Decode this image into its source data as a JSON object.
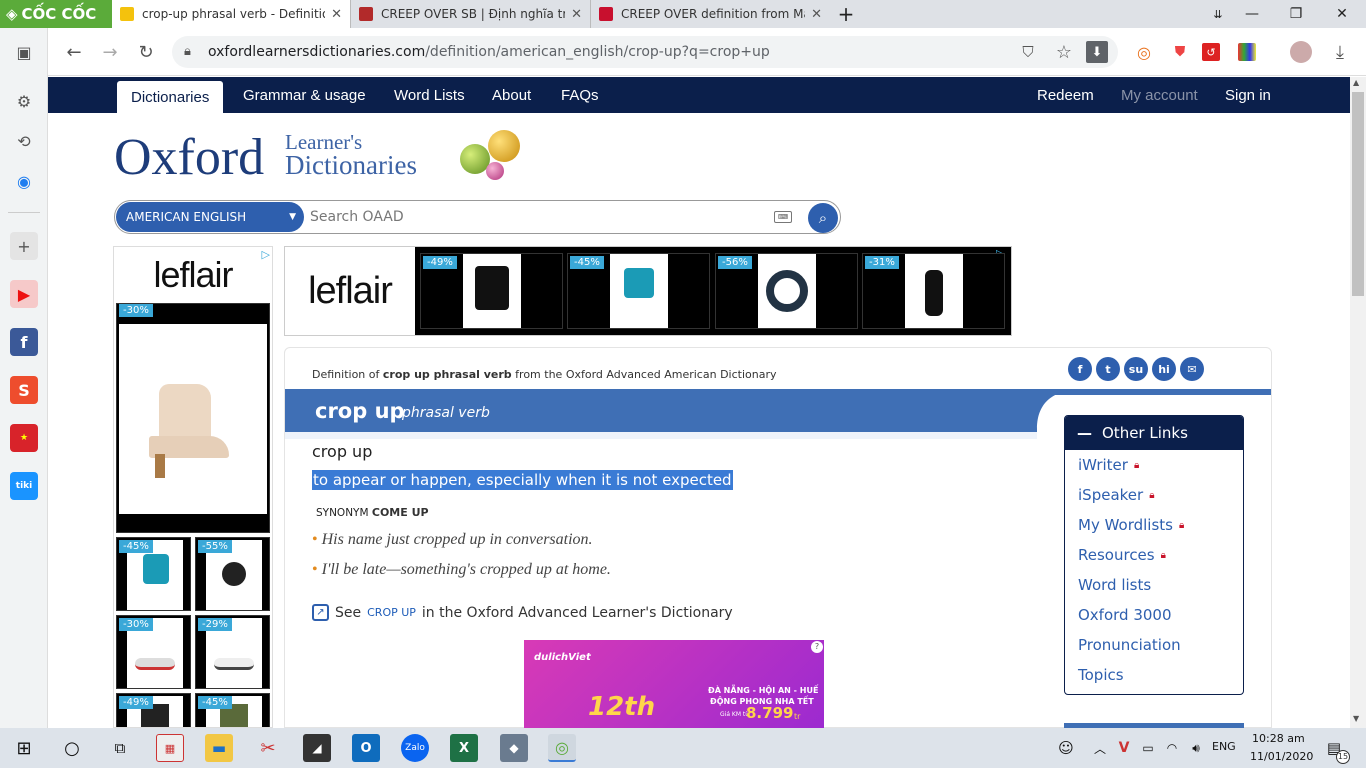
{
  "browser": {
    "brand": "CỐC CỐC",
    "tabs": [
      {
        "label": "crop-up phrasal verb - Definition, p",
        "color": "#f4c20d",
        "active": true
      },
      {
        "label": "CREEP OVER SB | Định nghĩa trong",
        "color": "#b22a2a",
        "active": false
      },
      {
        "label": "CREEP OVER definition from Macm",
        "color": "#c8102e",
        "active": false
      }
    ],
    "new_tab": "+",
    "url_host": "oxfordlearnersdictionaries.com",
    "url_path": "/definition/american_english/crop-up?q=crop+up"
  },
  "site_nav": {
    "items": [
      "Dictionaries",
      "Grammar & usage",
      "Word Lists",
      "About",
      "FAQs"
    ],
    "right": [
      "Redeem",
      "My account",
      "Sign in"
    ]
  },
  "logo": {
    "oxford": "Oxford",
    "learners": "Learner's",
    "dictionaries": "Dictionaries"
  },
  "search": {
    "lang": "AMERICAN ENGLISH",
    "placeholder": "Search OAAD"
  },
  "ads": {
    "brand": "leflair",
    "left_tags": [
      "-30%",
      "-45%",
      "-55%",
      "-30%",
      "-29%",
      "-49%",
      "-45%"
    ],
    "top_tags": [
      "-49%",
      "-45%",
      "-56%",
      "-31%"
    ],
    "bottom": {
      "brand": "dulichViet",
      "headline": "ĐÀ NẴNG - HỘI AN - HUẾ",
      "sub": "ĐỘNG PHONG NHA TẾT",
      "price_label": "Giá KM từ",
      "price": "8.799",
      "unit": "tr",
      "badge": "12th"
    }
  },
  "entry": {
    "definition_of": "Definition of",
    "headword_bold": "crop up phrasal verb",
    "source": "from the Oxford Advanced American Dictionary",
    "headword": "crop up",
    "pos": "phrasal verb",
    "sense_title": "crop up",
    "definition": "to appear or happen, especially when it is not expected",
    "synonym_label": "SYNONYM",
    "synonym": "COME UP",
    "examples": [
      "His name just cropped up in conversation.",
      "I'll be late—something's cropped up at home."
    ],
    "see_prefix": "See",
    "see_link": "CROP UP",
    "see_suffix": "in the Oxford Advanced Learner's Dictionary"
  },
  "share_icons": [
    "facebook-icon",
    "twitter-icon",
    "stumbleupon-icon",
    "hi5-icon",
    "email-icon"
  ],
  "other_links": {
    "title": "Other Links",
    "items": [
      {
        "label": "iWriter",
        "locked": true
      },
      {
        "label": "iSpeaker",
        "locked": true
      },
      {
        "label": "My Wordlists",
        "locked": true
      },
      {
        "label": "Resources",
        "locked": true
      },
      {
        "label": "Word lists",
        "locked": false
      },
      {
        "label": "Oxford 3000",
        "locked": false
      },
      {
        "label": "Pronunciation",
        "locked": false
      },
      {
        "label": "Topics",
        "locked": false
      }
    ]
  },
  "taskbar": {
    "lang": "ENG",
    "time": "10:28 am",
    "date": "11/01/2020",
    "notifications": "15"
  }
}
